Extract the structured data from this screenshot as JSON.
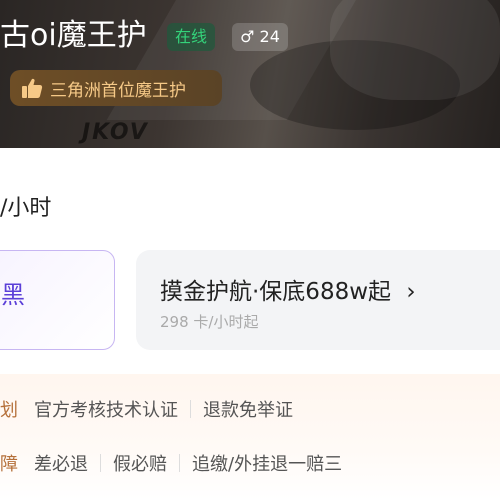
{
  "header": {
    "name": "古oi魔王护",
    "online_status": "在线",
    "gender_age": "♂ 24",
    "title_badge": "三角洲首位魔王护",
    "deco_text": "JKOV"
  },
  "pricing": {
    "unit": "/小时"
  },
  "cards": {
    "left_label": "黑",
    "right_title": "摸金护航·保底688w起",
    "right_arrow": "›",
    "right_sub": "298 卡/小时起"
  },
  "guarantees": {
    "row1": {
      "label": "划",
      "items": [
        "官方考核技术认证",
        "退款免举证"
      ]
    },
    "row2": {
      "label": "障",
      "items": [
        "差必退",
        "假必赔",
        "追缴/外挂退一赔三"
      ]
    }
  },
  "colors": {
    "online_green": "#34d27a",
    "badge_gold": "#f6c987",
    "accent_purple": "#5b3fd8",
    "guarantee_label": "#b5703a"
  }
}
